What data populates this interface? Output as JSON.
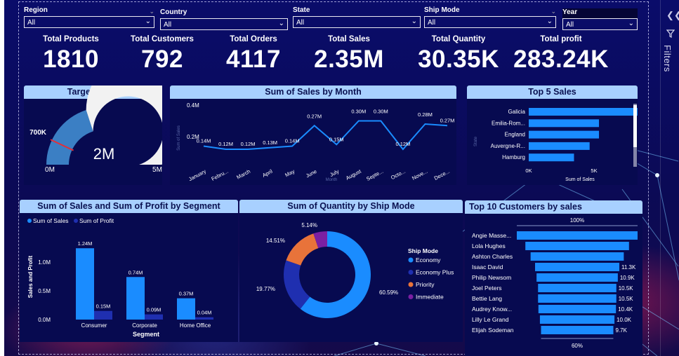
{
  "slicers": [
    {
      "label": "Region",
      "value": "All"
    },
    {
      "label": "Country",
      "value": "All"
    },
    {
      "label": "State",
      "value": "All"
    },
    {
      "label": "Ship Mode",
      "value": "All"
    },
    {
      "label": "Year",
      "value": "All"
    }
  ],
  "kpis": [
    {
      "title": "Total Products",
      "value": "1810"
    },
    {
      "title": "Total Customers",
      "value": "792"
    },
    {
      "title": "Total Orders",
      "value": "4117"
    },
    {
      "title": "Total Sales",
      "value": "2.35M"
    },
    {
      "title": "Total Quantity",
      "value": "30.35K"
    },
    {
      "title": "Total profit",
      "value": "283.24K"
    }
  ],
  "filters_pane": {
    "label": "Filters"
  },
  "colors": {
    "accent": "#1a8cff",
    "dark_blue": "#1f2fb0",
    "orange": "#e8733a",
    "purple": "#7b1fa2",
    "title_bg": "#a8d0ff",
    "gauge_fill": "#3b7fc4",
    "gauge_rest": "#f2f2f2"
  },
  "chart_data": [
    {
      "type": "gauge",
      "title": "Target Sales",
      "value_label": "2M",
      "min_label": "0M",
      "max_label": "5M",
      "target_label": "700K",
      "value": 2,
      "target": 0.7,
      "min": 0,
      "max": 5
    },
    {
      "type": "line",
      "title": "Sum of Sales by Month",
      "xlabel": "Month",
      "ylabel": "Sum of Sales",
      "categories": [
        "January",
        "Febru...",
        "March",
        "April",
        "May",
        "June",
        "July",
        "August",
        "Septe...",
        "Octo...",
        "Nove...",
        "Dece..."
      ],
      "values": [
        0.14,
        0.12,
        0.12,
        0.13,
        0.14,
        0.27,
        0.15,
        0.3,
        0.3,
        0.12,
        0.28,
        0.27
      ],
      "data_labels": [
        "0.14M",
        "0.12M",
        "0.12M",
        "0.13M",
        "0.14M",
        "0.27M",
        "0.15M",
        "0.30M",
        "0.30M",
        "0.12M",
        "0.28M",
        "0.27M"
      ],
      "yticks": [
        "0.2M",
        "0.4M"
      ],
      "ylim": [
        0,
        0.4
      ]
    },
    {
      "type": "bar",
      "orientation": "horizontal",
      "title": "Top 5 Sales",
      "xlabel": "Sum of Sales",
      "ylabel": "State",
      "categories": [
        "Galicia",
        "Emilia-Rom...",
        "England",
        "Auvergne-R...",
        "Hamburg"
      ],
      "values": [
        7.1,
        4.5,
        4.5,
        3.9,
        2.9
      ],
      "xticks": [
        "0K",
        "5K"
      ],
      "xlim": [
        0,
        10
      ]
    },
    {
      "type": "bar",
      "title": "Sum of Sales and Sum of Profit by Segment",
      "xlabel": "Segment",
      "ylabel": "Sales and Profit",
      "categories": [
        "Consumer",
        "Corporate",
        "Home Office"
      ],
      "series": [
        {
          "name": "Sum of Sales",
          "values": [
            1.24,
            0.74,
            0.37
          ],
          "labels": [
            "1.24M",
            "0.74M",
            "0.37M"
          ]
        },
        {
          "name": "Sum of Profit",
          "values": [
            0.15,
            0.09,
            0.04
          ],
          "labels": [
            "0.15M",
            "0.09M",
            "0.04M"
          ]
        }
      ],
      "yticks": [
        "0.0M",
        "0.5M",
        "1.0M"
      ],
      "ylim": [
        0,
        1.45
      ]
    },
    {
      "type": "pie",
      "donut": true,
      "title": "Sum of Quantity by Ship Mode",
      "legend_title": "Ship Mode",
      "categories": [
        "Economy",
        "Economy Plus",
        "Priority",
        "Immediate"
      ],
      "values": [
        60.59,
        19.77,
        14.51,
        5.14
      ],
      "labels": [
        "60.59%",
        "19.77%",
        "14.51%",
        "5.14%"
      ]
    },
    {
      "type": "funnel",
      "title": "Top 10 Customers by sales",
      "categories": [
        "Angie Masse...",
        "Lola Hughes",
        "Ashton Charles",
        "Isaac David",
        "Philip Newsom",
        "Joel Peters",
        "Bettie Lang",
        "Audrey Know...",
        "Lilly Le Grand",
        "Elijah Sodeman"
      ],
      "values": [
        16.2,
        13.9,
        12.5,
        11.3,
        10.9,
        10.5,
        10.5,
        10.4,
        10.0,
        9.7
      ],
      "labels": [
        "",
        "",
        "",
        "11.3K",
        "10.9K",
        "10.5K",
        "10.5K",
        "10.4K",
        "10.0K",
        "9.7K"
      ],
      "top_pct": "100%",
      "bottom_pct": "60%"
    }
  ]
}
